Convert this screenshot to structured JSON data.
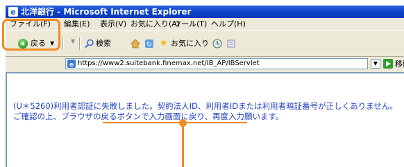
{
  "window": {
    "title": "北洋銀行 - Microsoft Internet Explorer"
  },
  "menu": {
    "items": [
      "ファイル(F)",
      "編集(E)",
      "表示(V)",
      "お気に入り(A)",
      "ツール(T)",
      "ヘルプ(H)"
    ]
  },
  "toolbar": {
    "back_label": "戻る",
    "search_label": "検索",
    "favorites_label": "お気に入り"
  },
  "address": {
    "url": "https://www2.suitebank.finemax.net/IB_AP/IBServlet",
    "go_label": "移動"
  },
  "content": {
    "error_message": "(U＊5260)利用者認証に失敗しました。契約法人ID、利用者IDまたは利用者暗証番号が正しくありません。ご確認の上、ブラウザの戻るボタンで入力画面に戻り、再度入力願います。"
  },
  "colors": {
    "highlight": "#f08a24",
    "error_text": "#1f3fc0",
    "titlebar": "#0a3fc7"
  }
}
